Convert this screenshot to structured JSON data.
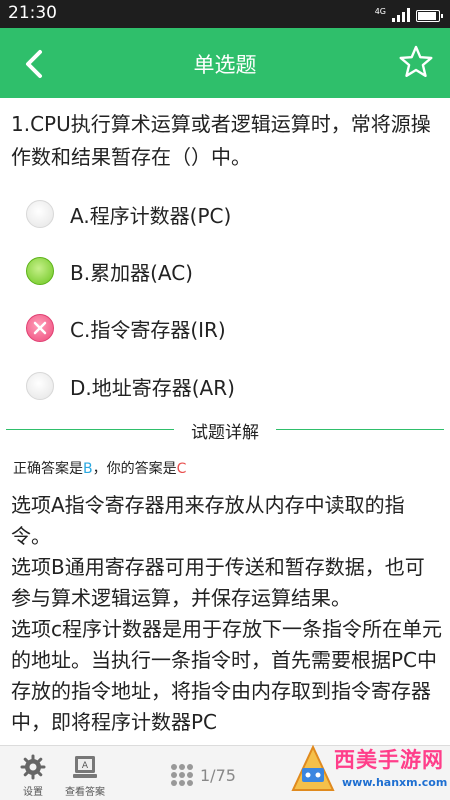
{
  "status_bar": {
    "time": "21:30",
    "network": "4G"
  },
  "header": {
    "title": "单选题"
  },
  "question": {
    "text": "1.CPU执行算术运算或者逻辑运算时，常将源操作数和结果暂存在（）中。"
  },
  "options": [
    {
      "label": "A.程序计数器(PC)",
      "state": "unselected"
    },
    {
      "label": "B.累加器(AC)",
      "state": "correct"
    },
    {
      "label": "C.指令寄存器(IR)",
      "state": "wrong"
    },
    {
      "label": "D.地址寄存器(AR)",
      "state": "unselected"
    }
  ],
  "detail": {
    "section_title": "试题详解",
    "correct_prefix": "正确答案是",
    "correct_answer": "B",
    "user_prefix": "，你的答案是",
    "user_answer": "C",
    "paragraphs": [
      "选项A指令寄存器用来存放从内存中读取的指令。",
      "选项B通用寄存器可用于传送和暂存数据，也可参与算术逻辑运算，并保存运算结果。",
      "选项c程序计数器是用于存放下一条指令所在单元的地址。当执行一条指令时，首先需要根据PC中存放的指令地址，将指令由内存取到指令寄存器中，即将程序计数器PC"
    ]
  },
  "bottom_bar": {
    "settings_label": "设置",
    "view_answer_label": "查看答案",
    "page": "1/75"
  },
  "watermark": {
    "text": "西美手游网",
    "url": "www.hanxm.com"
  },
  "colors": {
    "primary": "#2fbf6b",
    "correct_answer": "#2aa8e0",
    "user_answer": "#e8504f",
    "wrong_mark": "#ee4a7c",
    "correct_mark": "#6cc61f"
  }
}
